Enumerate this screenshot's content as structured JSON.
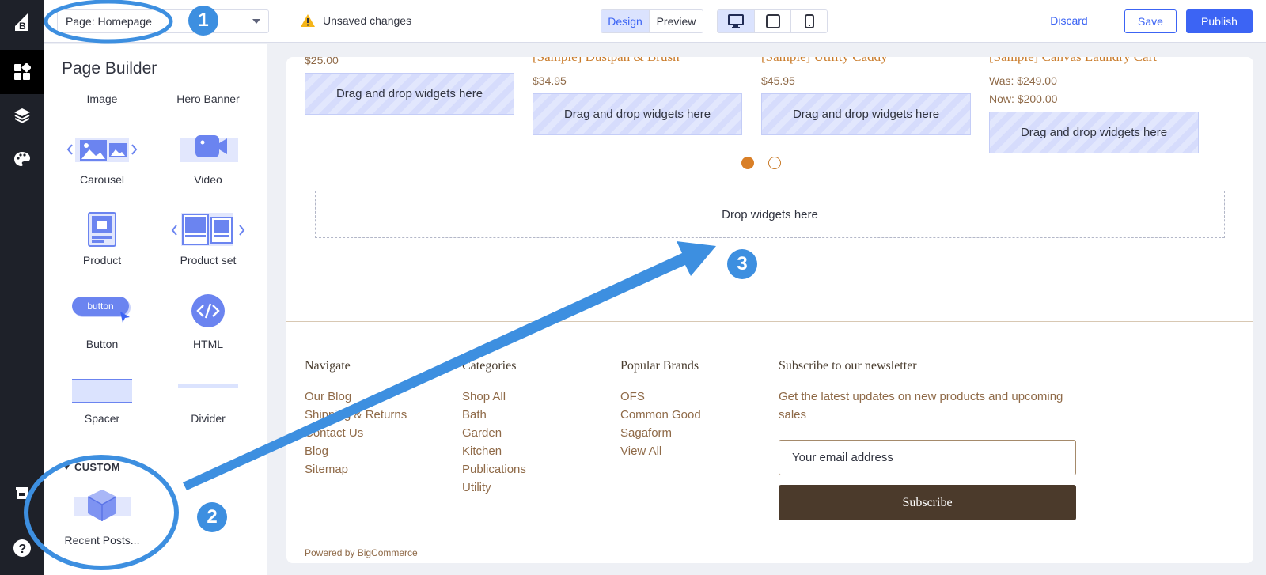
{
  "topbar": {
    "page_select": "Page: Homepage",
    "unsaved": "Unsaved changes",
    "view_modes": [
      "Design",
      "Preview"
    ],
    "discard": "Discard",
    "save": "Save",
    "publish": "Publish"
  },
  "panel": {
    "title": "Page Builder",
    "widgets": [
      "Image",
      "Hero Banner",
      "Carousel",
      "Video",
      "Product",
      "Product set",
      "Button",
      "HTML",
      "Spacer",
      "Divider"
    ],
    "button_preview_text": "button",
    "custom_header": "CUSTOM",
    "custom_widget": "Recent Posts..."
  },
  "canvas": {
    "products": [
      {
        "title": "",
        "price": "$25.00"
      },
      {
        "title": "[Sample] Dustpan & Brush",
        "price": "$34.95"
      },
      {
        "title": "[Sample] Utility Caddy",
        "price": "$45.95"
      },
      {
        "title": "[Sample] Canvas Laundry Cart",
        "was_label": "Was:",
        "was_price": "$249.00",
        "now": "Now: $200.00"
      }
    ],
    "drag_drop": "Drag and drop widgets here",
    "drop_here": "Drop widgets here",
    "footer": {
      "navigate": {
        "heading": "Navigate",
        "links": [
          "Our Blog",
          "Shipping & Returns",
          "Contact Us",
          "Blog",
          "Sitemap"
        ]
      },
      "categories": {
        "heading": "Categories",
        "links": [
          "Shop All",
          "Bath",
          "Garden",
          "Kitchen",
          "Publications",
          "Utility"
        ]
      },
      "brands": {
        "heading": "Popular Brands",
        "links": [
          "OFS",
          "Common Good",
          "Sagaform",
          "View All"
        ]
      },
      "newsletter": {
        "heading": "Subscribe to our newsletter",
        "description": "Get the latest updates on new products and upcoming sales",
        "email_placeholder": "Your email address",
        "button": "Subscribe"
      },
      "powered": "Powered by BigCommerce"
    }
  },
  "annotations": {
    "badges": [
      "1",
      "2",
      "3"
    ]
  },
  "colors": {
    "accent": "#3c64f4",
    "annotation": "#3d8fe0",
    "brand_dark": "#4b3a2b"
  }
}
